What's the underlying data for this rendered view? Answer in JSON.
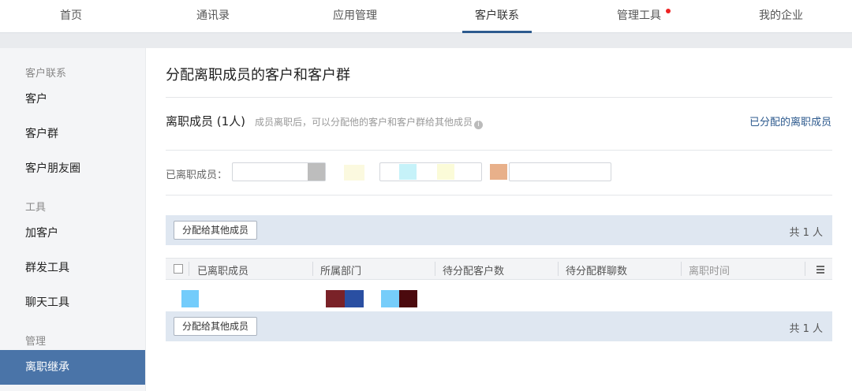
{
  "nav": {
    "items": [
      "首页",
      "通讯录",
      "应用管理",
      "客户联系",
      "管理工具",
      "我的企业"
    ],
    "active_index": 3,
    "badge_index": 4
  },
  "sidebar": {
    "section_customer": "客户联系",
    "customer_items": [
      "客户",
      "客户群",
      "客户朋友圈"
    ],
    "section_tools": "工具",
    "tool_items": [
      "加客户",
      "群发工具",
      "聊天工具"
    ],
    "section_manage": "管理",
    "manage_items": [
      "离职继承"
    ]
  },
  "main": {
    "title": "分配离职成员的客户和客户群",
    "member_heading": "离职成员 (1人)",
    "member_desc": "成员离职后，可以分配他的客户和客户群给其他成员",
    "assigned_link": "已分配的离职成员",
    "filter_label": "已离职成员："
  },
  "toolbar": {
    "assign_button": "分配给其他成员",
    "count": "共 1 人"
  },
  "table": {
    "columns": [
      "已离职成员",
      "所属部门",
      "待分配客户数",
      "待分配群聊数",
      "离职时间"
    ]
  },
  "colors": {
    "accent": "#2d5a8e",
    "sidebar_active": "#4a74a8",
    "badge": "#e22222"
  }
}
